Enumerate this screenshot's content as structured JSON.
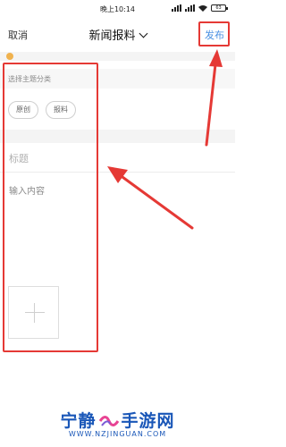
{
  "status_bar": {
    "time": "晚上10:14",
    "battery": "63"
  },
  "nav": {
    "cancel": "取消",
    "title": "新闻报料",
    "publish": "发布"
  },
  "notice": {
    "text": ""
  },
  "topic": {
    "label": "选择主题分类",
    "chips": [
      "原创",
      "报料"
    ]
  },
  "form": {
    "title_placeholder": "标题",
    "content_placeholder": "输入内容"
  },
  "watermark": {
    "name_left": "宁静",
    "name_right": "手游网",
    "url": "WWW.NZJINGUAN.COM"
  },
  "colors": {
    "annotation_red": "#e53935",
    "link_blue": "#4a90e2",
    "watermark_blue": "#1a57b8"
  }
}
